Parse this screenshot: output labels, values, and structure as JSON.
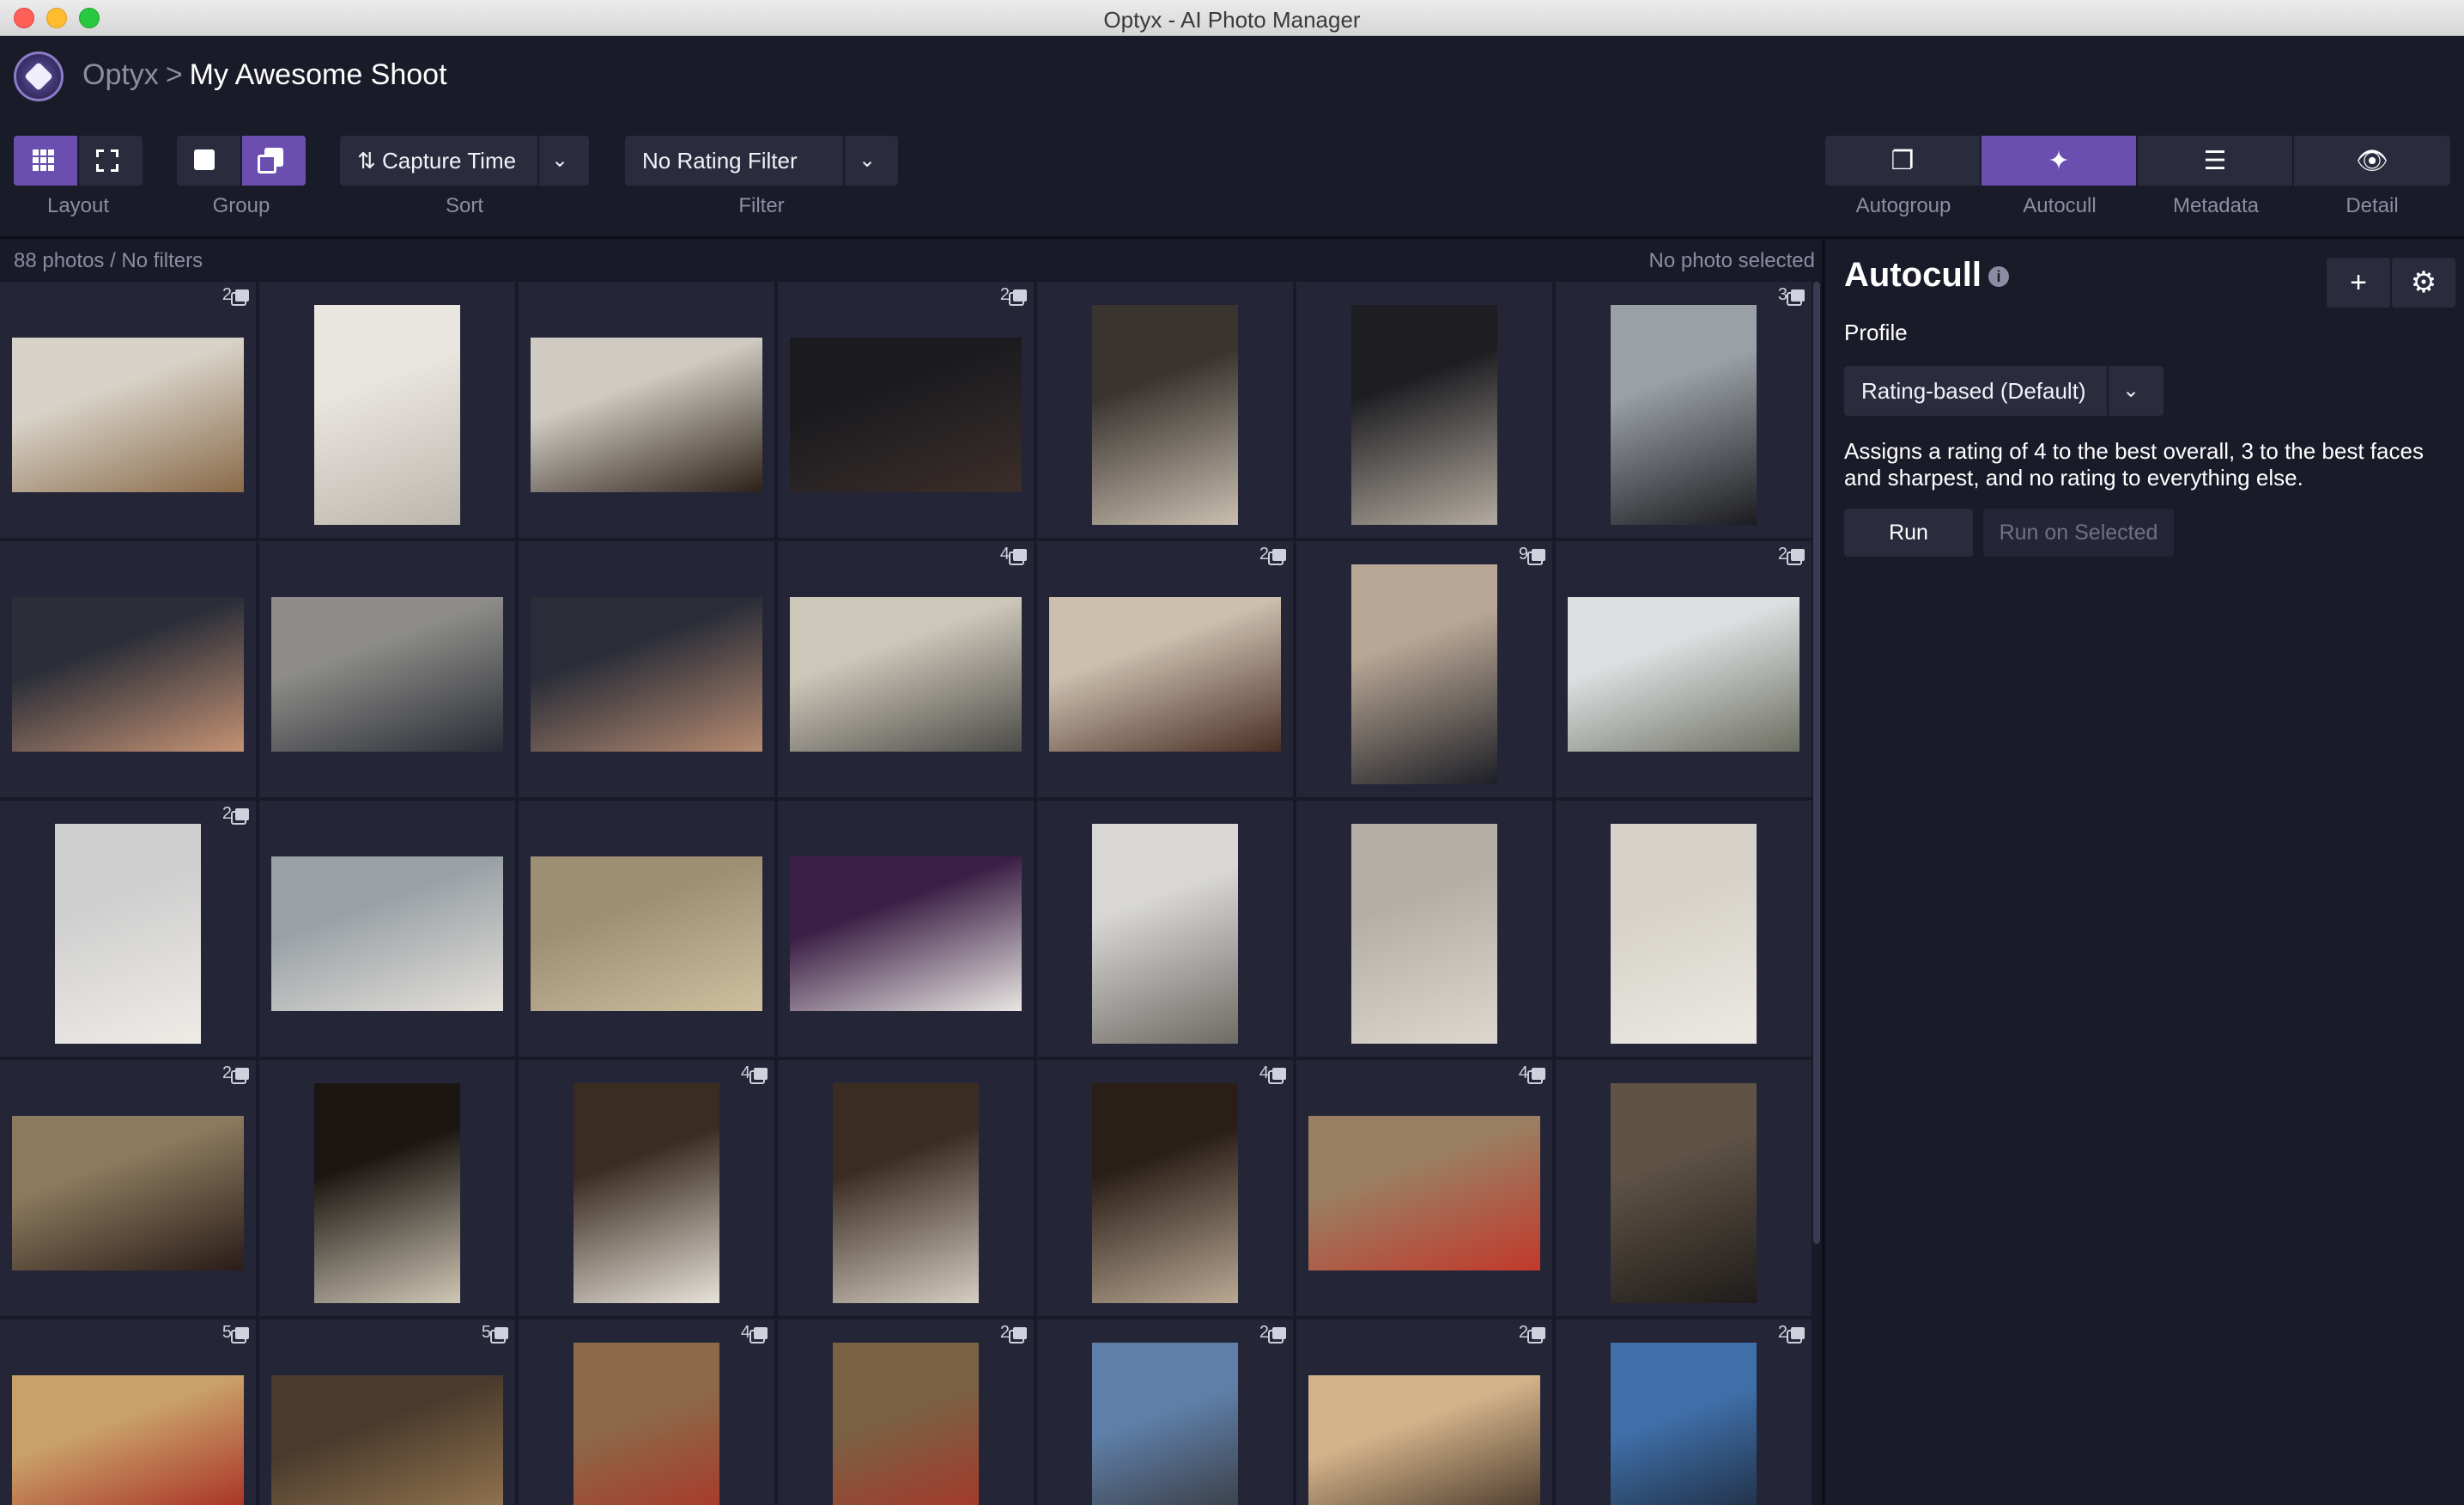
{
  "window": {
    "title": "Optyx - AI Photo Manager"
  },
  "breadcrumb": {
    "app": "Optyx",
    "separator": ">",
    "project": "My Awesome Shoot"
  },
  "toolbar": {
    "layout_label": "Layout",
    "group_label": "Group",
    "sort_value": "Capture Time",
    "sort_label": "Sort",
    "filter_value": "No Rating Filter",
    "filter_label": "Filter"
  },
  "tools": [
    {
      "label": "Autogroup",
      "icon": "stack-icon",
      "active": false
    },
    {
      "label": "Autocull",
      "icon": "magic-wand-icon",
      "active": true
    },
    {
      "label": "Metadata",
      "icon": "list-icon",
      "active": false
    },
    {
      "label": "Detail",
      "icon": "eye-icon",
      "active": false
    }
  ],
  "status": {
    "count": "88 photos / No filters",
    "selection": "No photo selected"
  },
  "autocull": {
    "title": "Autocull",
    "profile_label": "Profile",
    "profile_value": "Rating-based (Default)",
    "description": "Assigns a rating of 4 to the best overall, 3 to the best faces and sharpest, and no rating to everything else.",
    "run_label": "Run",
    "run_selected_label": "Run on Selected"
  },
  "grid": {
    "photos": [
      {
        "orient": "l",
        "badge": "2",
        "tone": [
          "#d8d3c8",
          "#8a6a4a"
        ]
      },
      {
        "orient": "p",
        "badge": "",
        "tone": [
          "#e9e5df",
          "#bcb6ad"
        ]
      },
      {
        "orient": "l",
        "badge": "",
        "tone": [
          "#cfcac2",
          "#2c2118"
        ]
      },
      {
        "orient": "l",
        "badge": "2",
        "tone": [
          "#1b1b1f",
          "#3b2e2a"
        ]
      },
      {
        "orient": "p",
        "badge": "",
        "tone": [
          "#3a3430",
          "#c9bfb0"
        ]
      },
      {
        "orient": "p",
        "badge": "",
        "tone": [
          "#1e1e22",
          "#b4aba0"
        ]
      },
      {
        "orient": "p",
        "badge": "3",
        "tone": [
          "#9aa0a6",
          "#1c1c20"
        ]
      },
      {
        "orient": "l",
        "badge": "",
        "tone": [
          "#2b2e38",
          "#c49274"
        ]
      },
      {
        "orient": "l",
        "badge": "",
        "tone": [
          "#8d8c88",
          "#2a2d36"
        ]
      },
      {
        "orient": "l",
        "badge": "",
        "tone": [
          "#2a2d38",
          "#b58a70"
        ]
      },
      {
        "orient": "l",
        "badge": "4",
        "tone": [
          "#cdc7b9",
          "#4c4b48"
        ]
      },
      {
        "orient": "l",
        "badge": "2",
        "tone": [
          "#cbbfae",
          "#4a2e24"
        ]
      },
      {
        "orient": "p",
        "badge": "9",
        "tone": [
          "#b9a795",
          "#1d1f26"
        ]
      },
      {
        "orient": "l",
        "badge": "2",
        "tone": [
          "#dcdfe0",
          "#6c6e62"
        ]
      },
      {
        "orient": "p",
        "badge": "2",
        "tone": [
          "#cfcfcf",
          "#efece7"
        ]
      },
      {
        "orient": "l",
        "badge": "",
        "tone": [
          "#9aa1a6",
          "#e4e0da"
        ]
      },
      {
        "orient": "l",
        "badge": "",
        "tone": [
          "#9d8f74",
          "#cdbf9f"
        ]
      },
      {
        "orient": "l",
        "badge": "",
        "tone": [
          "#3c1f46",
          "#e8e6e2"
        ]
      },
      {
        "orient": "p",
        "badge": "",
        "tone": [
          "#d8d7d5",
          "#6f6b66"
        ]
      },
      {
        "orient": "p",
        "badge": "",
        "tone": [
          "#b4aea6",
          "#dcd7cf"
        ]
      },
      {
        "orient": "p",
        "badge": "",
        "tone": [
          "#d6d2c9",
          "#ece9e3"
        ]
      },
      {
        "orient": "l",
        "badge": "2",
        "tone": [
          "#8b7a5e",
          "#2a1c18"
        ]
      },
      {
        "orient": "p",
        "badge": "",
        "tone": [
          "#1c1612",
          "#cfc7b5"
        ]
      },
      {
        "orient": "p",
        "badge": "4",
        "tone": [
          "#3a2c20",
          "#e7e2da"
        ]
      },
      {
        "orient": "p",
        "badge": "",
        "tone": [
          "#3b2c22",
          "#d5cdc2"
        ]
      },
      {
        "orient": "p",
        "badge": "4",
        "tone": [
          "#2a1f18",
          "#b9a893"
        ]
      },
      {
        "orient": "l",
        "badge": "4",
        "tone": [
          "#9a8063",
          "#c1392b"
        ]
      },
      {
        "orient": "p",
        "badge": "",
        "tone": [
          "#5f5346",
          "#1f1c1a"
        ]
      },
      {
        "orient": "l",
        "badge": "5",
        "tone": [
          "#c9a06a",
          "#a4221b"
        ]
      },
      {
        "orient": "l",
        "badge": "5",
        "tone": [
          "#4a3a2c",
          "#9c7c55"
        ]
      },
      {
        "orient": "p",
        "badge": "4",
        "tone": [
          "#8c6a48",
          "#b3261e"
        ]
      },
      {
        "orient": "p",
        "badge": "2",
        "tone": [
          "#7a6144",
          "#b6281f"
        ]
      },
      {
        "orient": "p",
        "badge": "2",
        "tone": [
          "#5f7fa8",
          "#2c2520"
        ]
      },
      {
        "orient": "l",
        "badge": "2",
        "tone": [
          "#d3b38a",
          "#3a2a20"
        ]
      },
      {
        "orient": "p",
        "badge": "2",
        "tone": [
          "#3f6fa8",
          "#151821"
        ]
      }
    ]
  },
  "colors": {
    "accent": "#6b4fb0",
    "background": "#191a27",
    "cell": "#242537",
    "button": "#2a2c3e"
  }
}
